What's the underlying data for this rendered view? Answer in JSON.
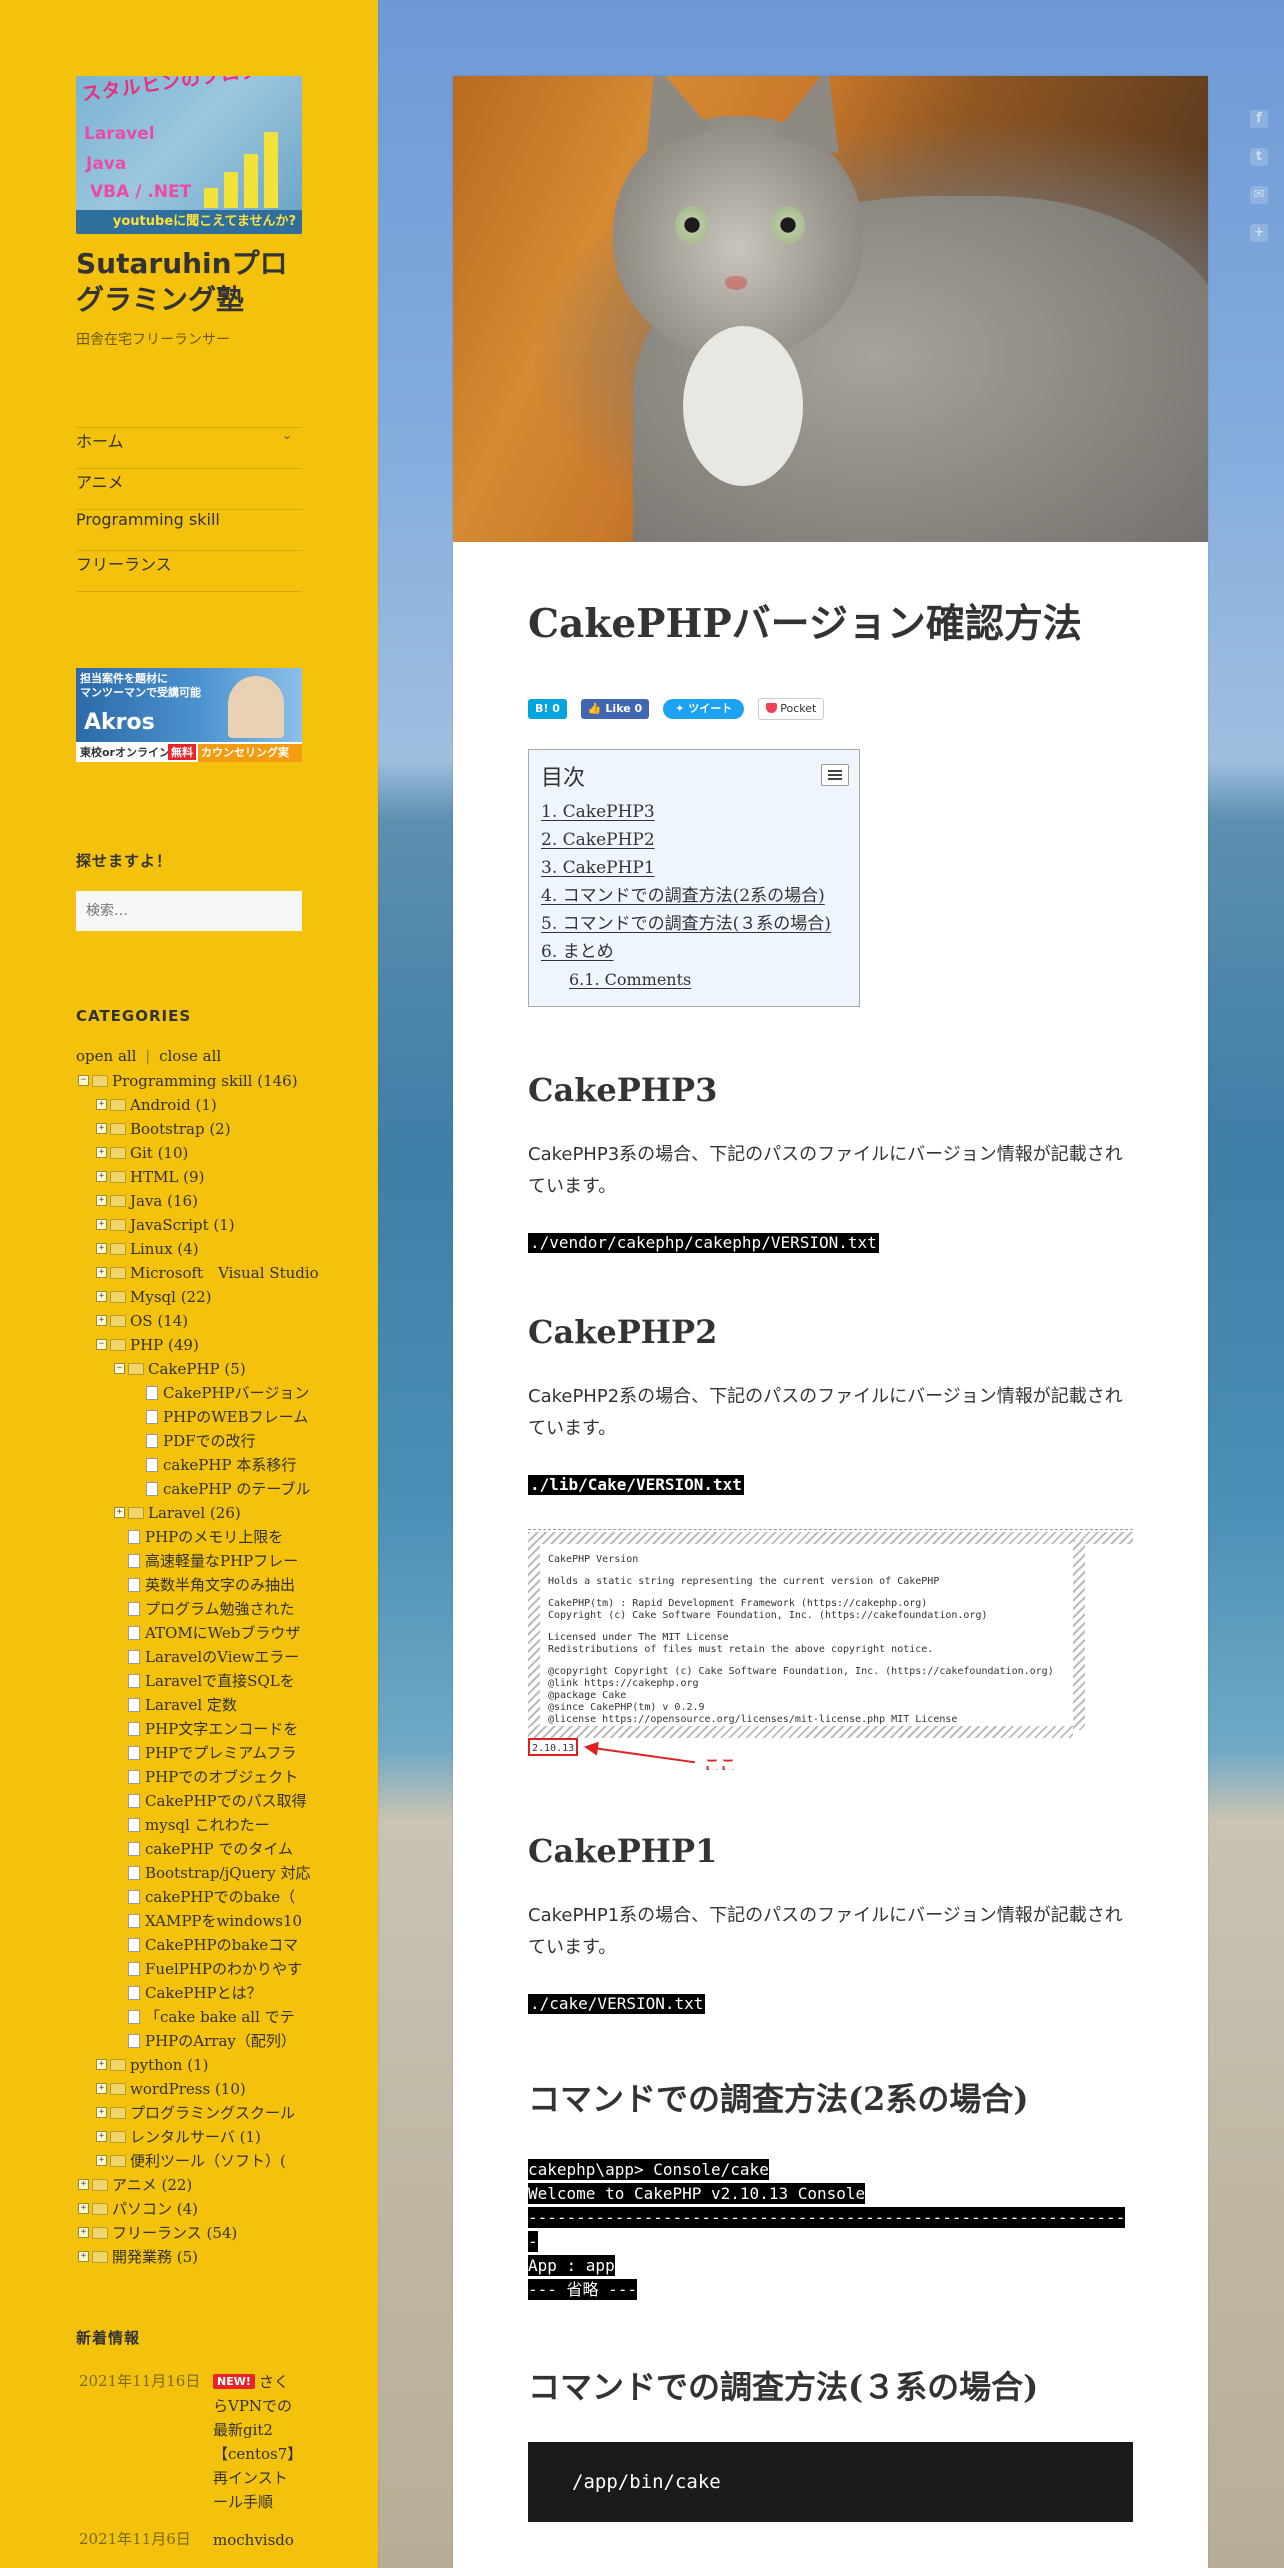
{
  "site": {
    "logo_banner": "スタルヒンのプログラミング塾",
    "logo_lines": [
      "Laravel",
      "Java",
      "VBA / .NET"
    ],
    "logo_foot": "youtubeに聞こえてませんか?",
    "title": "Sutaruhinプログラミング塾",
    "description": "田舎在宅フリーランサー"
  },
  "nav": {
    "items": [
      {
        "label": "ホーム"
      },
      {
        "label": "アニメ"
      },
      {
        "label": "Programming skill"
      },
      {
        "label": "フリーランス"
      }
    ]
  },
  "ad": {
    "top": "担当案件を題材に\nマンツーマンで受講可能",
    "brand": "Akros",
    "foot_left": "東校orオンライン",
    "foot_free": "無料",
    "foot_right": "カウンセリング実施中"
  },
  "search": {
    "title": "探せますよ！",
    "placeholder": "検索…"
  },
  "categories": {
    "title": "CATEGORIES",
    "open_all": "open all",
    "separator": "|",
    "close_all": "close all",
    "rows": [
      {
        "label": "Programming skill (146)",
        "depth": 0,
        "type": "folder-open"
      },
      {
        "label": "Android (1)",
        "depth": 1,
        "type": "folder"
      },
      {
        "label": "Bootstrap (2)",
        "depth": 1,
        "type": "folder"
      },
      {
        "label": "Git (10)",
        "depth": 1,
        "type": "folder"
      },
      {
        "label": "HTML (9)",
        "depth": 1,
        "type": "folder"
      },
      {
        "label": "Java (16)",
        "depth": 1,
        "type": "folder"
      },
      {
        "label": "JavaScript (1)",
        "depth": 1,
        "type": "folder"
      },
      {
        "label": "Linux (4)",
        "depth": 1,
        "type": "folder"
      },
      {
        "label": "Microsoft　Visual Studio",
        "depth": 1,
        "type": "folder"
      },
      {
        "label": "Mysql (22)",
        "depth": 1,
        "type": "folder"
      },
      {
        "label": "OS (14)",
        "depth": 1,
        "type": "folder"
      },
      {
        "label": "PHP (49)",
        "depth": 1,
        "type": "folder-open"
      },
      {
        "label": "CakePHP (5)",
        "depth": 2,
        "type": "folder-open"
      },
      {
        "label": "CakePHPバージョン",
        "depth": 3,
        "type": "doc"
      },
      {
        "label": "PHPのWEBフレーム",
        "depth": 3,
        "type": "doc"
      },
      {
        "label": "PDFでの改行",
        "depth": 3,
        "type": "doc"
      },
      {
        "label": "cakePHP 本系移行",
        "depth": 3,
        "type": "doc"
      },
      {
        "label": "cakePHP のテーブル",
        "depth": 3,
        "type": "doc"
      },
      {
        "label": "Laravel (26)",
        "depth": 2,
        "type": "folder"
      },
      {
        "label": "PHPのメモリ上限を",
        "depth": 2,
        "type": "doc"
      },
      {
        "label": "高速軽量なPHPフレー",
        "depth": 2,
        "type": "doc"
      },
      {
        "label": "英数半角文字のみ抽出",
        "depth": 2,
        "type": "doc"
      },
      {
        "label": "プログラム勉強された",
        "depth": 2,
        "type": "doc"
      },
      {
        "label": "ATOMにWebブラウザ",
        "depth": 2,
        "type": "doc"
      },
      {
        "label": "LaravelのViewエラー",
        "depth": 2,
        "type": "doc"
      },
      {
        "label": "Laravelで直接SQLを",
        "depth": 2,
        "type": "doc"
      },
      {
        "label": "Laravel 定数",
        "depth": 2,
        "type": "doc"
      },
      {
        "label": "PHP文字エンコードを",
        "depth": 2,
        "type": "doc"
      },
      {
        "label": "PHPでプレミアムフラ",
        "depth": 2,
        "type": "doc"
      },
      {
        "label": "PHPでのオブジェクト",
        "depth": 2,
        "type": "doc"
      },
      {
        "label": "CakePHPでのパス取得",
        "depth": 2,
        "type": "doc"
      },
      {
        "label": "mysql これわたー",
        "depth": 2,
        "type": "doc"
      },
      {
        "label": "cakePHP でのタイム",
        "depth": 2,
        "type": "doc"
      },
      {
        "label": "Bootstrap/jQuery 対応",
        "depth": 2,
        "type": "doc"
      },
      {
        "label": "cakePHPでのbake（",
        "depth": 2,
        "type": "doc"
      },
      {
        "label": "XAMPPをwindows10",
        "depth": 2,
        "type": "doc"
      },
      {
        "label": "CakePHPのbakeコマ",
        "depth": 2,
        "type": "doc"
      },
      {
        "label": "FuelPHPのわかりやす",
        "depth": 2,
        "type": "doc"
      },
      {
        "label": "CakePHPとは？",
        "depth": 2,
        "type": "doc"
      },
      {
        "label": "「cake bake all でテ",
        "depth": 2,
        "type": "doc"
      },
      {
        "label": "PHPのArray（配列）",
        "depth": 2,
        "type": "doc"
      },
      {
        "label": "python (1)",
        "depth": 1,
        "type": "folder"
      },
      {
        "label": "wordPress (10)",
        "depth": 1,
        "type": "folder"
      },
      {
        "label": "プログラミングスクール",
        "depth": 1,
        "type": "folder"
      },
      {
        "label": "レンタルサーバ (1)",
        "depth": 1,
        "type": "folder"
      },
      {
        "label": "便利ツール（ソフト）(",
        "depth": 1,
        "type": "folder"
      },
      {
        "label": "アニメ (22)",
        "depth": 0,
        "type": "folder"
      },
      {
        "label": "パソコン (4)",
        "depth": 0,
        "type": "folder"
      },
      {
        "label": "フリーランス (54)",
        "depth": 0,
        "type": "folder"
      },
      {
        "label": "開発業務 (5)",
        "depth": 0,
        "type": "folder"
      }
    ]
  },
  "news": {
    "title": "新着情報",
    "items": [
      {
        "date": "2021年11月16日",
        "badge": "NEW!",
        "text": "さくらVPNでの最新git2【centos7】再インストール手順"
      },
      {
        "date": "2021年11月6日",
        "badge": "",
        "text": "mochvisdo"
      }
    ]
  },
  "article": {
    "title": "CakePHPバージョン確認方法",
    "share": {
      "hatena": "B! 0",
      "facebook": "Like 0",
      "twitter": "ツイート",
      "pocket": "Pocket"
    },
    "toc": {
      "heading": "目次",
      "items": [
        {
          "label": "1. CakePHP3",
          "sub": false
        },
        {
          "label": "2. CakePHP2",
          "sub": false
        },
        {
          "label": "3. CakePHP1",
          "sub": false
        },
        {
          "label": "4. コマンドでの調査方法(2系の場合)",
          "sub": false
        },
        {
          "label": "5. コマンドでの調査方法(３系の場合)",
          "sub": false
        },
        {
          "label": "6. まとめ",
          "sub": false
        },
        {
          "label": "6.1. Comments",
          "sub": true
        }
      ]
    },
    "sections": {
      "cake3": {
        "heading": "CakePHP3",
        "text": "CakePHP3系の場合、下記のパスのファイルにバージョン情報が記載されています。",
        "path": "./vendor/cakephp/cakephp/VERSION.txt"
      },
      "cake2": {
        "heading": "CakePHP2",
        "text": "CakePHP2系の場合、下記のパスのファイルにバージョン情報が記載されています。",
        "path": "./lib/Cake/VERSION.txt"
      },
      "screenshot": {
        "lines": [
          "CakePHP Version",
          "Holds a static string representing the current version of CakePHP",
          "CakePHP(tm) : Rapid Development Framework (https://cakephp.org)",
          "Copyright (c) Cake Software Foundation, Inc. (https://cakefoundation.org)",
          "Licensed under The MIT License",
          "Redistributions of files must retain the above copyright notice.",
          "@copyright     Copyright (c) Cake Software Foundation, Inc. (https://cakefoundation.org)",
          "@link          https://cakephp.org",
          "@package       Cake",
          "@since         CakePHP(tm) v 0.2.9",
          "@license       https://opensource.org/licenses/mit-license.php MIT License"
        ],
        "version": "2.10.13",
        "callout": "ここ"
      },
      "cake1": {
        "heading": "CakePHP1",
        "text": "CakePHP1系の場合、下記のパスのファイルにバージョン情報が記載されています。",
        "path": "./cake/VERSION.txt"
      },
      "cmd2": {
        "heading": "コマンドでの調査方法(2系の場合)",
        "lines": [
          "cakephp\\app> Console/cake",
          "Welcome to CakePHP v2.10.13 Console",
          "---------------------------------------------------------------",
          "App : app",
          "--- 省略 ---"
        ]
      },
      "cmd3": {
        "heading": "コマンドでの調査方法(３系の場合)",
        "code": "/app/bin/cake"
      }
    }
  },
  "colors": {
    "sidebar": "#f4c20d",
    "new_badge": "#e8232a"
  }
}
